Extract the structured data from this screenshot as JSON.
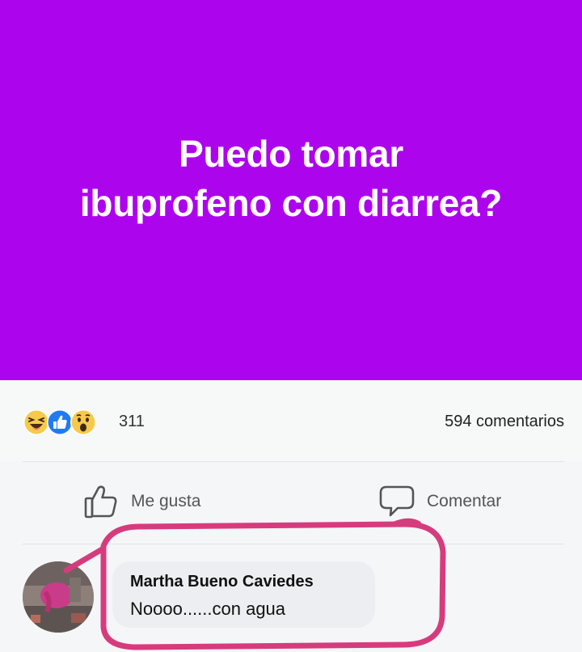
{
  "post": {
    "text_line1": "Puedo tomar",
    "text_line2": "ibuprofeno con diarrea?",
    "background_color": "#ad04ee"
  },
  "reactions": {
    "icons": [
      "haha-reaction-icon",
      "like-reaction-icon",
      "wow-reaction-icon"
    ],
    "count": "311",
    "comments": "594 comentarios"
  },
  "actions": {
    "like_label": "Me gusta",
    "comment_label": "Comentar"
  },
  "comment": {
    "author": "Martha Bueno Caviedes",
    "text": "Noooo......con agua"
  },
  "annotation": {
    "color": "#d63c7d"
  }
}
